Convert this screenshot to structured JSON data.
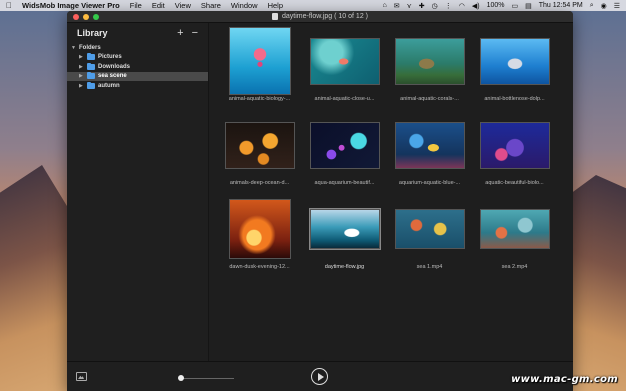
{
  "menubar": {
    "app_name": "WidsMob Image Viewer Pro",
    "menus": [
      "File",
      "Edit",
      "View",
      "Share",
      "Window",
      "Help"
    ],
    "battery": "100%",
    "clock": "Thu 12:54 PM"
  },
  "window": {
    "title": "daytime-flow.jpg ( 10 of 12 )"
  },
  "sidebar": {
    "title": "Library",
    "add_label": "+",
    "remove_label": "−",
    "folders_label": "Folders",
    "folders": [
      {
        "label": "Pictures",
        "selected": false
      },
      {
        "label": "Downloads",
        "selected": false
      },
      {
        "label": "sea scene",
        "selected": true
      },
      {
        "label": "autumn",
        "selected": false
      }
    ]
  },
  "thumbnails": [
    {
      "caption": "animal-aquatic-biology-..."
    },
    {
      "caption": "animal-aquatic-close-u..."
    },
    {
      "caption": "animal-aquatic-corals-..."
    },
    {
      "caption": "animal-bottlenose-dolp..."
    },
    {
      "caption": "animals-deep-ocean-d..."
    },
    {
      "caption": "aqua-aquarium-beautif..."
    },
    {
      "caption": "aquarium-aquatic-blue-..."
    },
    {
      "caption": "aquatic-beautiful-biolo..."
    },
    {
      "caption": "dawn-dusk-evening-12..."
    },
    {
      "caption": "daytime-flow.jpg"
    },
    {
      "caption": "sea 1.mp4"
    },
    {
      "caption": "sea 2.mp4"
    }
  ],
  "footer": {
    "zoom_level": 0
  },
  "watermark": "www.mac-gm.com"
}
